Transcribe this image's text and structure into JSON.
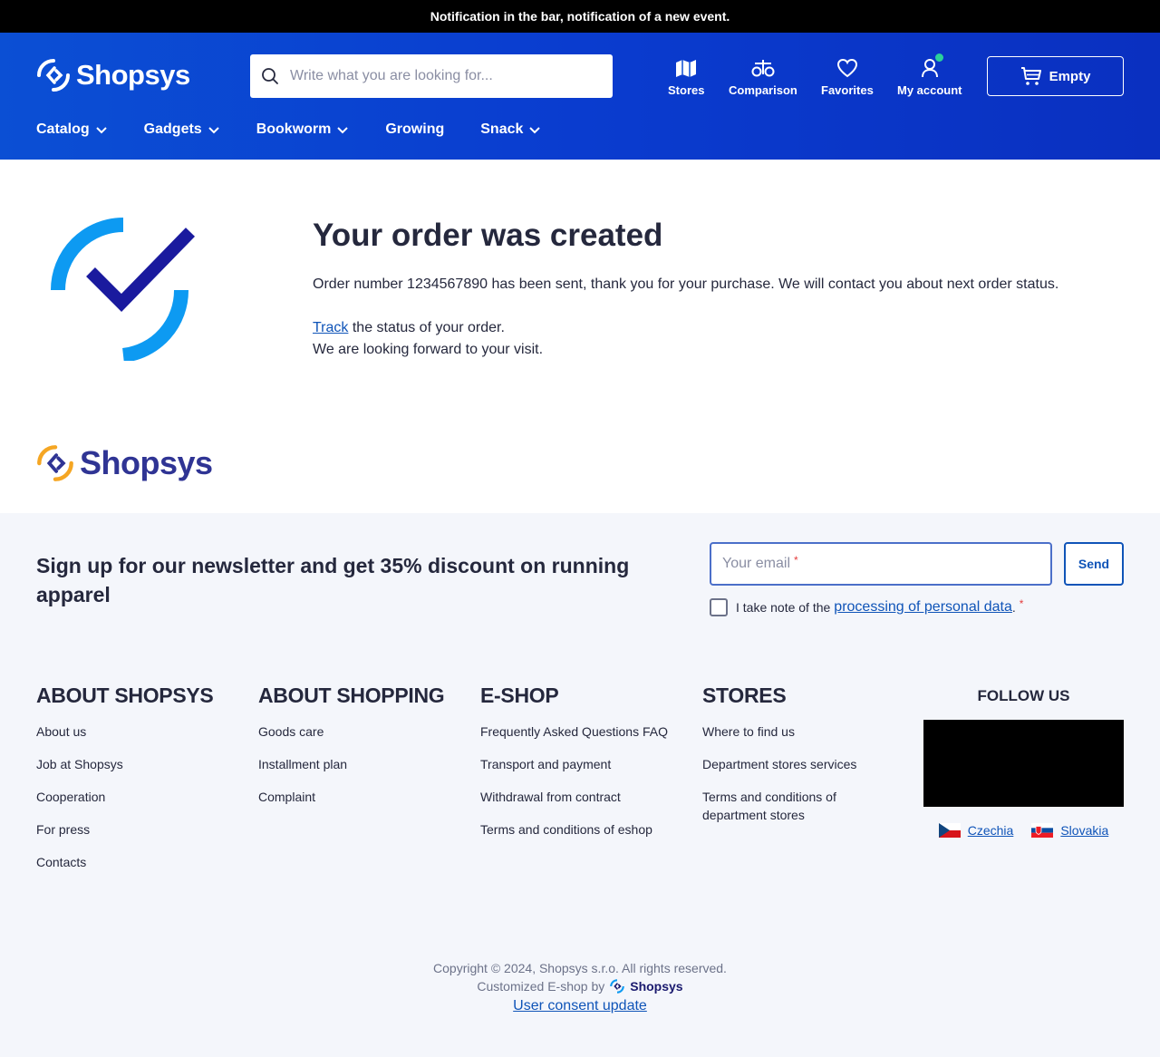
{
  "notification": "Notification in the bar, notification of a new event.",
  "header": {
    "logo_text": "Shopsys",
    "search_placeholder": "Write what you are looking for...",
    "nav": {
      "stores": "Stores",
      "comparison": "Comparison",
      "favorites": "Favorites",
      "account": "My account"
    },
    "cart_label": "Empty",
    "categories": [
      "Catalog",
      "Gadgets",
      "Bookworm",
      "Growing",
      "Snack"
    ]
  },
  "order": {
    "title": "Your order was created",
    "message": "Order number 1234567890 has been sent, thank you for your purchase. We will contact you about next order status.",
    "track_link": "Track",
    "track_rest": " the status of your order.",
    "visit": "We are looking forward to your visit."
  },
  "footer_logo_text": "Shopsys",
  "newsletter": {
    "title": "Sign up for our newsletter and get 35% discount on running apparel",
    "email_placeholder": "Your email",
    "required_mark": "*",
    "send_label": "Send",
    "consent_prefix": "I take note of the",
    "consent_link": "processing of personal data",
    "consent_suffix": "."
  },
  "columns": [
    {
      "title": "ABOUT SHOPSYS",
      "links": [
        "About us",
        "Job at Shopsys",
        "Cooperation",
        "For press",
        "Contacts"
      ]
    },
    {
      "title": "ABOUT SHOPPING",
      "links": [
        "Goods care",
        "Installment plan",
        "Complaint"
      ]
    },
    {
      "title": "E-SHOP",
      "links": [
        "Frequently Asked Questions FAQ",
        "Transport and payment",
        "Withdrawal from contract",
        "Terms and conditions of eshop"
      ]
    },
    {
      "title": "STORES",
      "links": [
        "Where to find us",
        "Department stores services",
        "Terms and conditions of department stores"
      ]
    }
  ],
  "follow": {
    "title": "FOLLOW US",
    "countries": [
      "Czechia",
      "Slovakia"
    ]
  },
  "copyright": {
    "line": "Copyright © 2024, Shopsys s.r.o. All rights reserved.",
    "made_by": "Customized E-shop by",
    "made_by_logo": "Shopsys",
    "consent_update": "User consent update"
  },
  "colors": {
    "header_blue": "#0b4fd4",
    "check_light": "#0d9af2",
    "check_dark": "#1a1a9e",
    "link": "#0f54b8"
  }
}
